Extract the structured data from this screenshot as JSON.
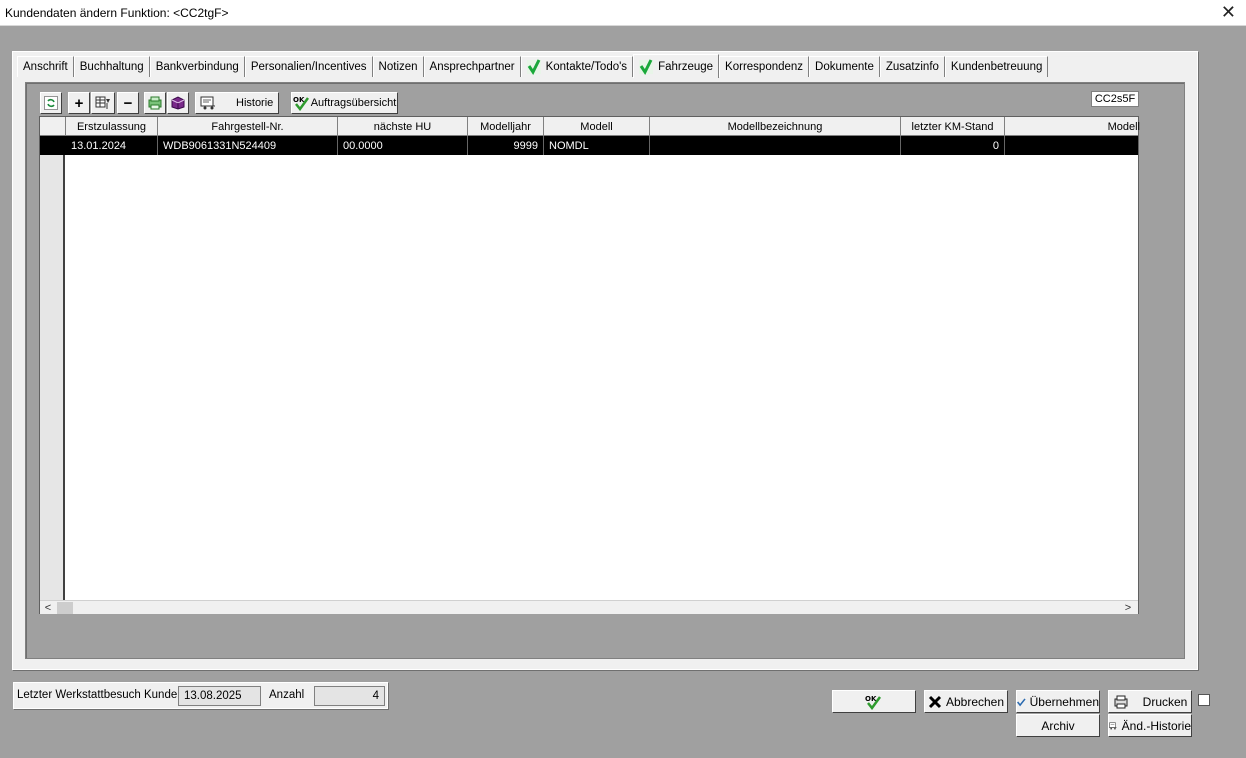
{
  "window": {
    "title": "Kundendaten ändern   Funktion: <CC2tgF>",
    "close": "✕"
  },
  "tabs": [
    {
      "label": "Anschrift"
    },
    {
      "label": "Buchhaltung"
    },
    {
      "label": "Bankverbindung"
    },
    {
      "label": "Personalien/Incentives"
    },
    {
      "label": "Notizen"
    },
    {
      "label": "Ansprechpartner"
    },
    {
      "label": "Kontakte/Todo's"
    },
    {
      "label": "Fahrzeuge"
    },
    {
      "label": "Korrespondenz"
    },
    {
      "label": "Dokumente"
    },
    {
      "label": "Zusatzinfo"
    },
    {
      "label": "Kundenbetreuung"
    }
  ],
  "toolbar": {
    "add": "+",
    "remove": "−",
    "historie": "Historie",
    "auftrag": "Auftragsübersicht",
    "ok_badge": "OK"
  },
  "code_box": "CC2s5F",
  "grid": {
    "headers": [
      "Erstzulassung",
      "Fahrgestell-Nr.",
      "nächste HU",
      "Modelljahr",
      "Modell",
      "Modellbezeichnung",
      "letzter KM-Stand",
      "Modell"
    ],
    "rows": [
      {
        "erstzulassung": "13.01.2024",
        "fin": "WDB9061331N524409",
        "hu": "00.0000",
        "modelljahr": "9999",
        "modell": "NOMDL",
        "bezeichnung": "",
        "km": "0",
        "modell2": ""
      }
    ],
    "scroll_left": "<",
    "scroll_right": ">"
  },
  "status": {
    "visit_label": "Letzter Werkstattbesuch Kunde",
    "visit_value": "13.08.2025",
    "count_label": "Anzahl",
    "count_value": "4"
  },
  "buttons": {
    "ok_badge": "OK",
    "abbrechen": "Abbrechen",
    "uebernehmen": "Übernehmen",
    "drucken": "Drucken",
    "archiv": "Archiv",
    "aend_historie": "Änd.-Historie"
  },
  "colors": {
    "check_green": "#1aa83a",
    "ok_green": "#2e9b2e",
    "selection": "#000000"
  }
}
